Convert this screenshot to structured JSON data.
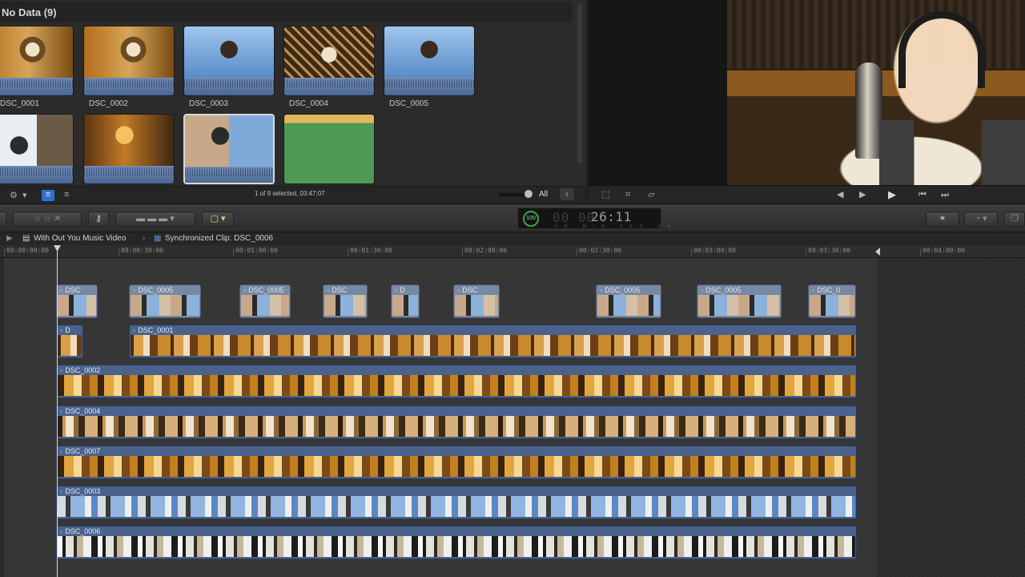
{
  "browser": {
    "title": "No Data  (9)",
    "clips": [
      {
        "label": "DSC_0001",
        "style": "img-studio"
      },
      {
        "label": "DSC_0002",
        "style": "img-studio"
      },
      {
        "label": "DSC_0003",
        "style": "img-sky"
      },
      {
        "label": "DSC_0004",
        "style": "img-cage"
      },
      {
        "label": "DSC_0005",
        "style": "img-sky"
      },
      {
        "label": "",
        "style": "img-window"
      },
      {
        "label": "",
        "style": "img-warm"
      },
      {
        "label": "",
        "style": "img-split"
      },
      {
        "label": "",
        "style": "img-green"
      }
    ],
    "status": "1 of 9 selected, 03:47:07",
    "filter": "All"
  },
  "path": {
    "project": "With Out You Music Video",
    "clip": "Synchronized Clip: DSC_0006"
  },
  "timecode": {
    "badge": "100",
    "dim_digits": "00 00",
    "value": "26:11",
    "units": "HR MIN SEC FR"
  },
  "ruler": [
    "00:00:00:00",
    "00:00:30:00",
    "00:01:00:00",
    "00:01:30:00",
    "00:02:00:00",
    "00:02:30:00",
    "00:03:00:00",
    "00:03:30:00",
    "00:04:00:00"
  ],
  "timeline": {
    "upper_clips": [
      "DSC",
      "DSC_0005",
      "DSC_0005",
      "DSC",
      "D",
      "DSC",
      "DSC_0005",
      "DSC_0005",
      "DSC_0"
    ],
    "tracks": [
      {
        "label": "DSC_0001",
        "style": "strip-studio"
      },
      {
        "label": "DSC_0002",
        "style": "strip-warm"
      },
      {
        "label": "DSC_0004",
        "style": "strip-cage"
      },
      {
        "label": "DSC_0007",
        "style": "strip-warm"
      },
      {
        "label": "DSC_0003",
        "style": "strip-sky"
      },
      {
        "label": "DSC_0006",
        "style": "strip-window"
      }
    ],
    "short_clip_label": "D"
  },
  "icons": {
    "gear": "⚙",
    "list": "≡",
    "play": "▶",
    "prev": "◀",
    "next": "▶",
    "key": "⚷",
    "wand": "✶"
  },
  "colors": {
    "clip_blue": "#4a628c",
    "timecode_green": "#3fa34d"
  }
}
